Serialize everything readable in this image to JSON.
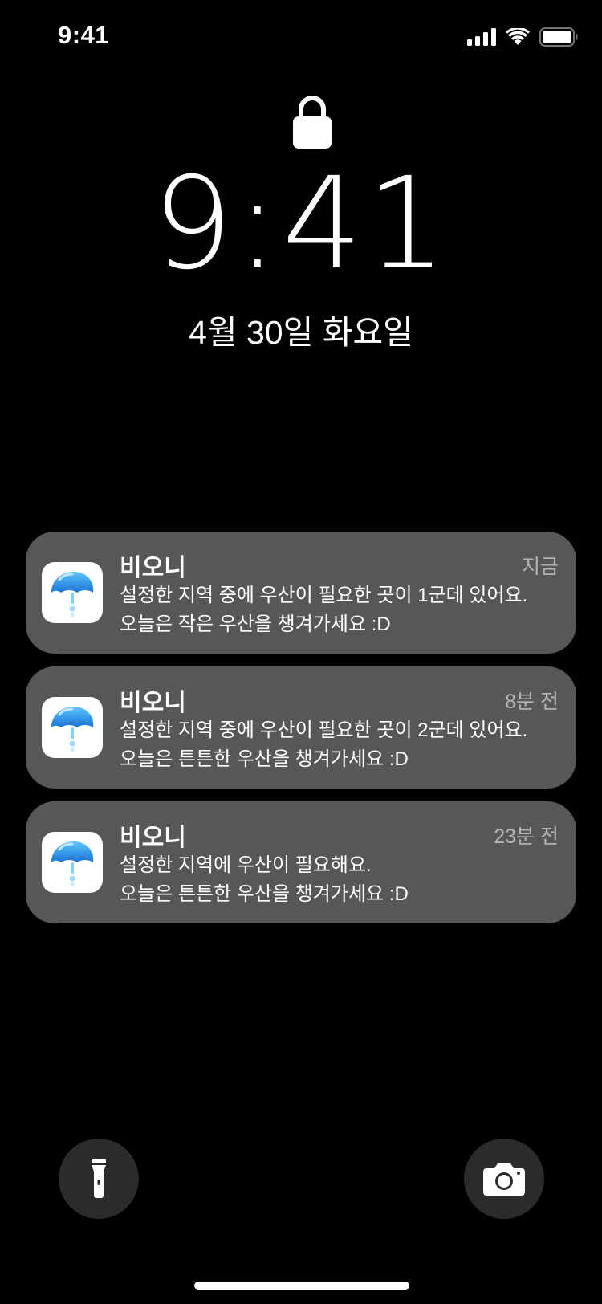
{
  "status_bar": {
    "time": "9:41"
  },
  "lock_screen": {
    "time_hour": "9",
    "time_minutes": ":41",
    "date": "4월 30일 화요일"
  },
  "notifications": [
    {
      "app": "비오니",
      "time": "지금",
      "line1": "설정한 지역 중에 우산이 필요한 곳이 1군데 있어요.",
      "line2": "오늘은 작은 우산을 챙겨가세요 :D"
    },
    {
      "app": "비오니",
      "time": "8분 전",
      "line1": "설정한 지역 중에 우산이 필요한 곳이 2군데 있어요.",
      "line2": "오늘은 튼튼한 우산을 챙겨가세요 :D"
    },
    {
      "app": "비오니",
      "time": "23분 전",
      "line1": "설정한 지역에 우산이 필요해요.",
      "line2": "오늘은 튼튼한 우산을 챙겨가세요 :D"
    }
  ],
  "icons": {
    "app": "umbrella-icon",
    "flashlight": "flashlight-icon",
    "camera": "camera-icon",
    "lock": "lock-icon"
  },
  "colors": {
    "background": "#000000",
    "notification_bg": "#575757",
    "umbrella_blue": "#2a8be0"
  }
}
